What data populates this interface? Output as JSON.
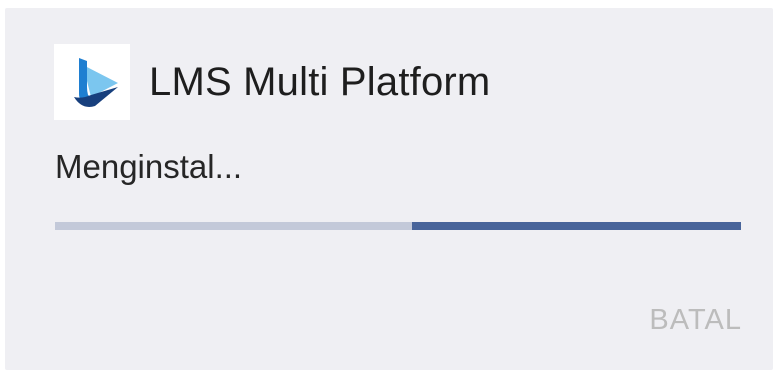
{
  "app": {
    "title": "LMS Multi Platform",
    "icon": "lms-play-logo-icon",
    "icon_colors": {
      "primary": "#1f7fd1",
      "light": "#7bc6ef",
      "dark": "#173f7d"
    }
  },
  "install": {
    "status_text": "Menginstal...",
    "progress": {
      "indeterminate": true,
      "segment_start_fraction": 0.52,
      "segment_end_fraction": 1.0,
      "track_color": "#c3c9d9",
      "fill_color": "#48649a"
    }
  },
  "actions": {
    "cancel_label": "BATAL"
  }
}
